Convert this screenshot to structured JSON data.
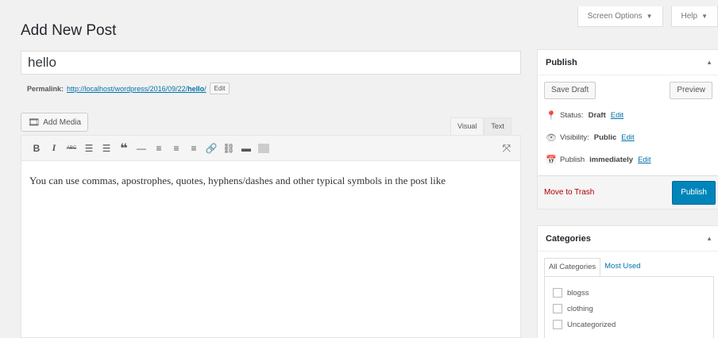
{
  "screen_meta": {
    "screen_options": "Screen Options",
    "help": "Help",
    "arrow": "▼"
  },
  "page_title": "Add New Post",
  "title_value": "hello",
  "permalink": {
    "label": "Permalink:",
    "url_prefix": "http://localhost/wordpress/2016/09/22/",
    "slug": "hello",
    "url_suffix": "/",
    "edit": "Edit"
  },
  "add_media": "Add Media",
  "editor_tabs": [
    "Visual",
    "Text"
  ],
  "toolbar": {
    "bold": "B",
    "italic": "I",
    "strike": "ABC",
    "ul": "☰",
    "ol": "☰",
    "quote": "❝",
    "hr": "—",
    "align_left": "≡",
    "align_center": "≡",
    "align_right": "≡",
    "link": "🔗",
    "unlink": "⛓",
    "more": "▬",
    "fullscreen": "⤧"
  },
  "content_text": "You can use commas, apostrophes, quotes, hyphens/dashes and other typical symbols in the post like",
  "publish": {
    "title": "Publish",
    "save_draft": "Save Draft",
    "preview": "Preview",
    "status_label": "Status:",
    "status_value": "Draft",
    "visibility_label": "Visibility:",
    "visibility_value": "Public",
    "schedule_label": "Publish",
    "schedule_value": "immediately",
    "edit": "Edit",
    "move_to_trash": "Move to Trash",
    "publish_button": "Publish"
  },
  "categories": {
    "title": "Categories",
    "tabs": [
      "All Categories",
      "Most Used"
    ],
    "items": [
      "blogss",
      "clothing",
      "Uncategorized"
    ]
  },
  "toggle_arrow": "▲"
}
